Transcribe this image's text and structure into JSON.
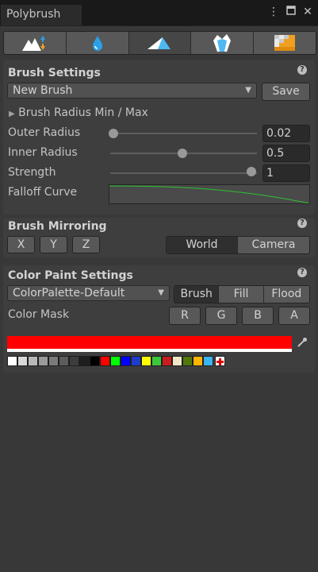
{
  "window": {
    "title": "Polybrush"
  },
  "toolbar": {
    "tools": [
      {
        "icon": "raise-lower-icon"
      },
      {
        "icon": "smooth-drop-icon"
      },
      {
        "icon": "paint-brush-icon"
      },
      {
        "icon": "prefab-crystal-icon"
      },
      {
        "icon": "texture-blend-icon"
      }
    ],
    "active_index": 2
  },
  "brush_settings": {
    "title": "Brush Settings",
    "preset": "New Brush",
    "save_label": "Save",
    "radius_toggle": "Brush Radius Min / Max",
    "outer_radius": {
      "label": "Outer Radius",
      "value": "0.02",
      "fraction": 0.0
    },
    "inner_radius": {
      "label": "Inner Radius",
      "value": "0.5",
      "fraction": 0.5
    },
    "strength": {
      "label": "Strength",
      "value": "1",
      "fraction": 1.0
    },
    "falloff_label": "Falloff Curve",
    "curve_color": "#2ec22e"
  },
  "brush_mirroring": {
    "title": "Brush Mirroring",
    "axes": [
      "X",
      "Y",
      "Z"
    ],
    "spaces": [
      "World",
      "Camera"
    ],
    "selected_space": "World"
  },
  "color_paint": {
    "title": "Color Paint Settings",
    "palette": "ColorPalette-Default",
    "modes": [
      "Brush",
      "Fill",
      "Flood"
    ],
    "selected_mode": "Brush",
    "mask_label": "Color Mask",
    "channels": [
      "R",
      "G",
      "B",
      "A"
    ],
    "current_color": "#ff0000",
    "swatches": [
      "#ffffff",
      "#d8d8d8",
      "#b8b8b8",
      "#9a9a9a",
      "#7a7a7a",
      "#5c5c5c",
      "#3c3c3c",
      "#1e1e1e",
      "#000000",
      "#ff0000",
      "#00ff00",
      "#0000ff",
      "#1e3cc8",
      "#ffff00",
      "#3cc83c",
      "#c81e1e",
      "#f0e6c8",
      "#50780a",
      "#ffb400",
      "#3cb4f0"
    ]
  }
}
